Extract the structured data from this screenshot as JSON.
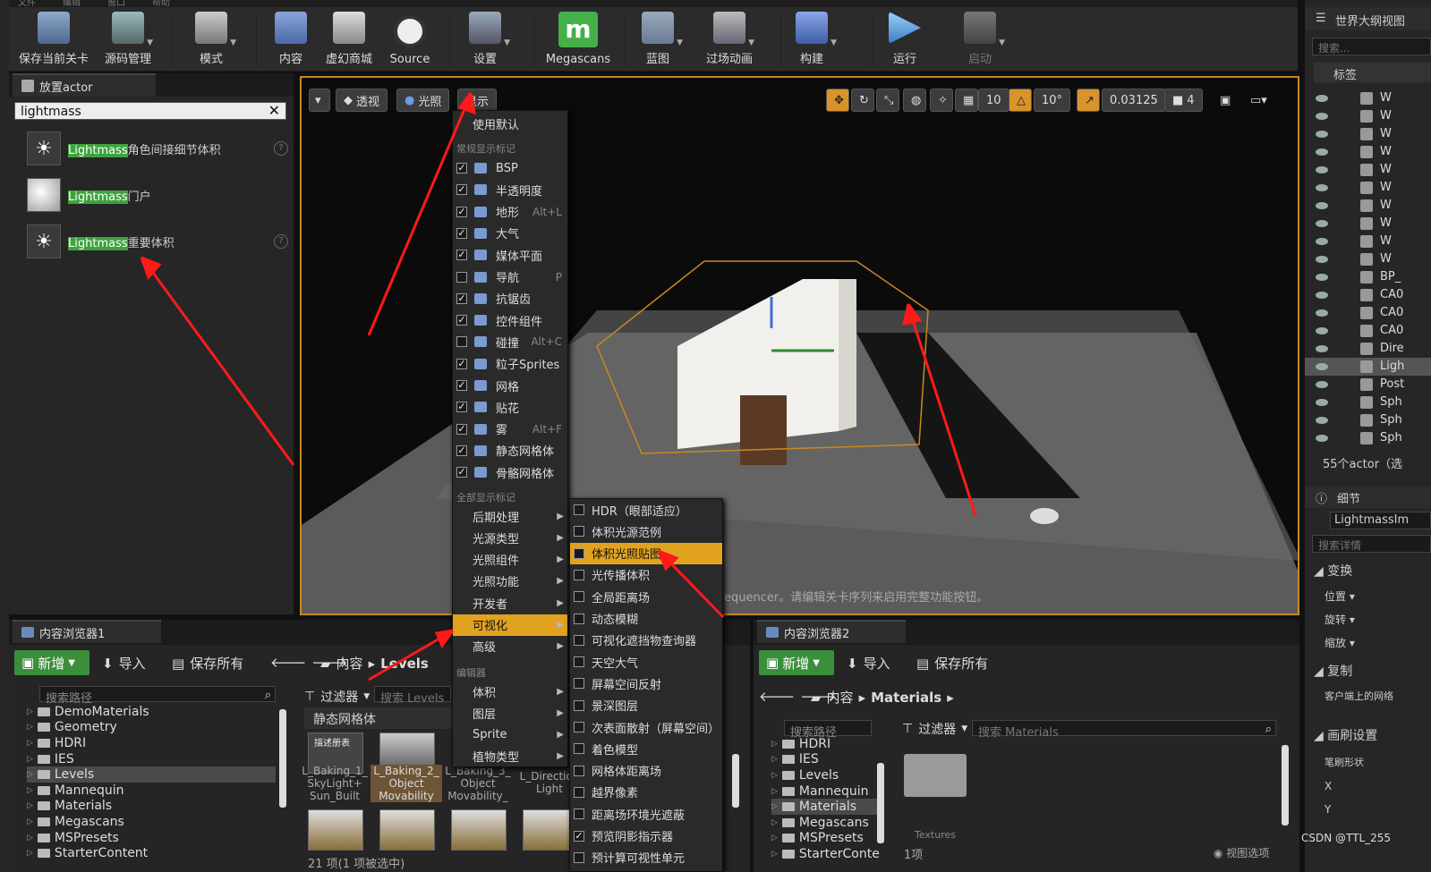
{
  "menubar": {
    "items": [
      "文件",
      "编辑",
      "窗口",
      "帮助"
    ]
  },
  "toolbar": {
    "buttons": [
      {
        "label": "保存当前关卡",
        "icon": "save-icon"
      },
      {
        "label": "源码管理",
        "icon": "source-control-icon"
      },
      {
        "label": "模式",
        "icon": "modes-icon"
      },
      {
        "label": "内容",
        "icon": "content-icon"
      },
      {
        "label": "虚幻商城",
        "icon": "marketplace-icon"
      },
      {
        "label": "Source",
        "icon": "source-icon"
      },
      {
        "label": "设置",
        "icon": "settings-icon"
      },
      {
        "label": "Megascans",
        "icon": "megascans-icon"
      },
      {
        "label": "蓝图",
        "icon": "blueprint-icon"
      },
      {
        "label": "过场动画",
        "icon": "cinematics-icon"
      },
      {
        "label": "构建",
        "icon": "build-icon"
      },
      {
        "label": "运行",
        "icon": "play-icon"
      },
      {
        "label": "启动",
        "icon": "launch-icon"
      }
    ]
  },
  "place_panel": {
    "tab": "放置actor",
    "search_value": "lightmass",
    "items": [
      {
        "hl": "Lightmass",
        "rest": "角色间接细节体积"
      },
      {
        "hl": "Lightmass",
        "rest": "门户"
      },
      {
        "hl": "Lightmass",
        "rest": "重要体积"
      }
    ]
  },
  "viewport": {
    "btn_perspective": "透视",
    "btn_lit": "光照",
    "btn_show": "显示",
    "grid_value": "10",
    "rot_value": "10°",
    "scale_value": "0.03125",
    "cam_speed": "4",
    "notice": "equencer。请编辑关卡序列来启用完整功能按钮。"
  },
  "show_menu": {
    "use_default": "使用默认",
    "common_header": "常规显示标记",
    "common": [
      {
        "label": "BSP",
        "checked": true,
        "shortcut": ""
      },
      {
        "label": "半透明度",
        "checked": true,
        "shortcut": ""
      },
      {
        "label": "地形",
        "checked": true,
        "shortcut": "Alt+L"
      },
      {
        "label": "大气",
        "checked": true,
        "shortcut": ""
      },
      {
        "label": "媒体平面",
        "checked": true,
        "shortcut": ""
      },
      {
        "label": "导航",
        "checked": false,
        "shortcut": "P"
      },
      {
        "label": "抗锯齿",
        "checked": true,
        "shortcut": ""
      },
      {
        "label": "控件组件",
        "checked": true,
        "shortcut": ""
      },
      {
        "label": "碰撞",
        "checked": false,
        "shortcut": "Alt+C"
      },
      {
        "label": "粒子Sprites",
        "checked": true,
        "shortcut": ""
      },
      {
        "label": "网格",
        "checked": true,
        "shortcut": ""
      },
      {
        "label": "贴花",
        "checked": true,
        "shortcut": ""
      },
      {
        "label": "雾",
        "checked": true,
        "shortcut": "Alt+F"
      },
      {
        "label": "静态网格体",
        "checked": true,
        "shortcut": ""
      },
      {
        "label": "骨骼网格体",
        "checked": true,
        "shortcut": ""
      }
    ],
    "all_header": "全部显示标记",
    "all": [
      "后期处理",
      "光源类型",
      "光照组件",
      "光照功能",
      "开发者",
      "可视化",
      "高级"
    ],
    "editor_header": "编辑器",
    "editor": [
      "体积",
      "图层",
      "Sprite",
      "植物类型"
    ]
  },
  "visualize_menu": {
    "items": [
      {
        "label": "HDR（眼部适应）",
        "checked": false
      },
      {
        "label": "体积光源范例",
        "checked": false
      },
      {
        "label": "体积光照贴图",
        "checked": false
      },
      {
        "label": "光传播体积",
        "checked": false
      },
      {
        "label": "全局距离场",
        "checked": false
      },
      {
        "label": "动态模糊",
        "checked": false
      },
      {
        "label": "可视化遮挡物查询器",
        "checked": false
      },
      {
        "label": "天空大气",
        "checked": false
      },
      {
        "label": "屏幕空间反射",
        "checked": false
      },
      {
        "label": "景深图层",
        "checked": false
      },
      {
        "label": "次表面散射（屏幕空间）",
        "checked": false
      },
      {
        "label": "着色模型",
        "checked": false
      },
      {
        "label": "网格体距离场",
        "checked": false
      },
      {
        "label": "越界像素",
        "checked": false
      },
      {
        "label": "距离场环境光遮蔽",
        "checked": false
      },
      {
        "label": "预览阴影指示器",
        "checked": true
      },
      {
        "label": "预计算可视性单元",
        "checked": false
      }
    ]
  },
  "cb1": {
    "tab": "内容浏览器1",
    "new": "新增",
    "import": "导入",
    "save_all": "保存所有",
    "path1": "内容",
    "path2": "Levels",
    "search_path": "搜索路径",
    "filter": "过滤器",
    "search_levels": "搜索 Levels",
    "tree": [
      "DemoMaterials",
      "Geometry",
      "HDRI",
      "IES",
      "Levels",
      "Mannequin",
      "Materials",
      "Megascans",
      "MSPresets",
      "StarterContent"
    ],
    "category": "静态网格体",
    "thumbs": [
      {
        "top": "描述册表",
        "label": "L_Baking_1_\nSkyLight+\nSun_Built"
      },
      {
        "top": "",
        "label": "L_Baking_2_\nObject\nMovability"
      },
      {
        "top": "",
        "label": "L_Baking_3_\nObject\nMovability_"
      },
      {
        "top": "",
        "label": "L_Direction\nLight"
      }
    ],
    "status": "21 项(1 项被选中)"
  },
  "cb2": {
    "tab": "内容浏览器2",
    "new": "新增",
    "import": "导入",
    "save_all": "保存所有",
    "path1": "内容",
    "path2": "Materials",
    "search_path": "搜索路径",
    "filter": "过滤器",
    "search_materials": "搜索 Materials",
    "tree": [
      "HDRI",
      "IES",
      "Levels",
      "Mannequin",
      "Materials",
      "Megascans",
      "MSPresets",
      "StarterConte"
    ],
    "folder_label": "Textures",
    "status": "1项",
    "view_options": "视图选项"
  },
  "outliner": {
    "tab": "世界大纲视图",
    "search": "搜索...",
    "label_col": "标签",
    "rows": [
      "W",
      "W",
      "W",
      "W",
      "W",
      "W",
      "W",
      "W",
      "W",
      "W",
      "BP_",
      "CA0",
      "CA0",
      "CA0",
      "Dire",
      "Ligh",
      "Post",
      "Sph",
      "Sph",
      "Sph"
    ],
    "count": "55个actor（选"
  },
  "details": {
    "tab": "细节",
    "object": "LightmassIm",
    "search": "搜索详情",
    "transform": "变换",
    "position": "位置",
    "rotation": "旋转",
    "scale": "缩放",
    "copy": "复制",
    "client_note": "客户端上的网络",
    "brush": "画刷设置",
    "brush_shape": "笔刷形状",
    "x": "X",
    "y": "Y"
  },
  "watermark": "CSDN @TTL_255",
  "colors": {
    "accent": "#e0a21f",
    "green": "#3da33d",
    "arrow": "#ff1a1a"
  }
}
